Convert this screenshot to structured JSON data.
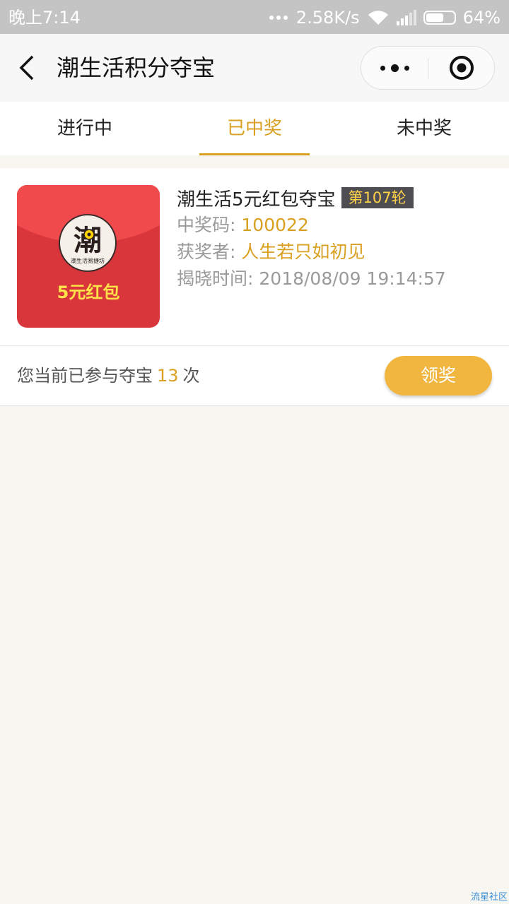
{
  "status_bar": {
    "time": "晚上7:14",
    "network_speed": "2.58K/s",
    "battery": "64%",
    "battery_level": 0.64
  },
  "nav": {
    "title": "潮生活积分夺宝"
  },
  "tabs": [
    {
      "label": "进行中",
      "active": false
    },
    {
      "label": "已中奖",
      "active": true
    },
    {
      "label": "未中奖",
      "active": false
    }
  ],
  "prize": {
    "thumb_text": "5元红包",
    "logo_char": "潮",
    "logo_subtext": "潮生活易捷坊",
    "title": "潮生活5元红包夺宝",
    "round": "第107轮",
    "code_label": "中奖码:",
    "code_value": "100022",
    "winner_label": "获奖者:",
    "winner_value": "人生若只如初见",
    "time_label": "揭晓时间:",
    "time_value": "2018/08/09 19:14:57"
  },
  "footer": {
    "participate_prefix": "您当前已参与夺宝",
    "participate_count": "13",
    "participate_suffix": "次",
    "claim_label": "领奖"
  },
  "watermark": "流星社区",
  "colors": {
    "accent": "#d9a021",
    "button": "#f0b640",
    "red_packet": "#d8363a"
  }
}
